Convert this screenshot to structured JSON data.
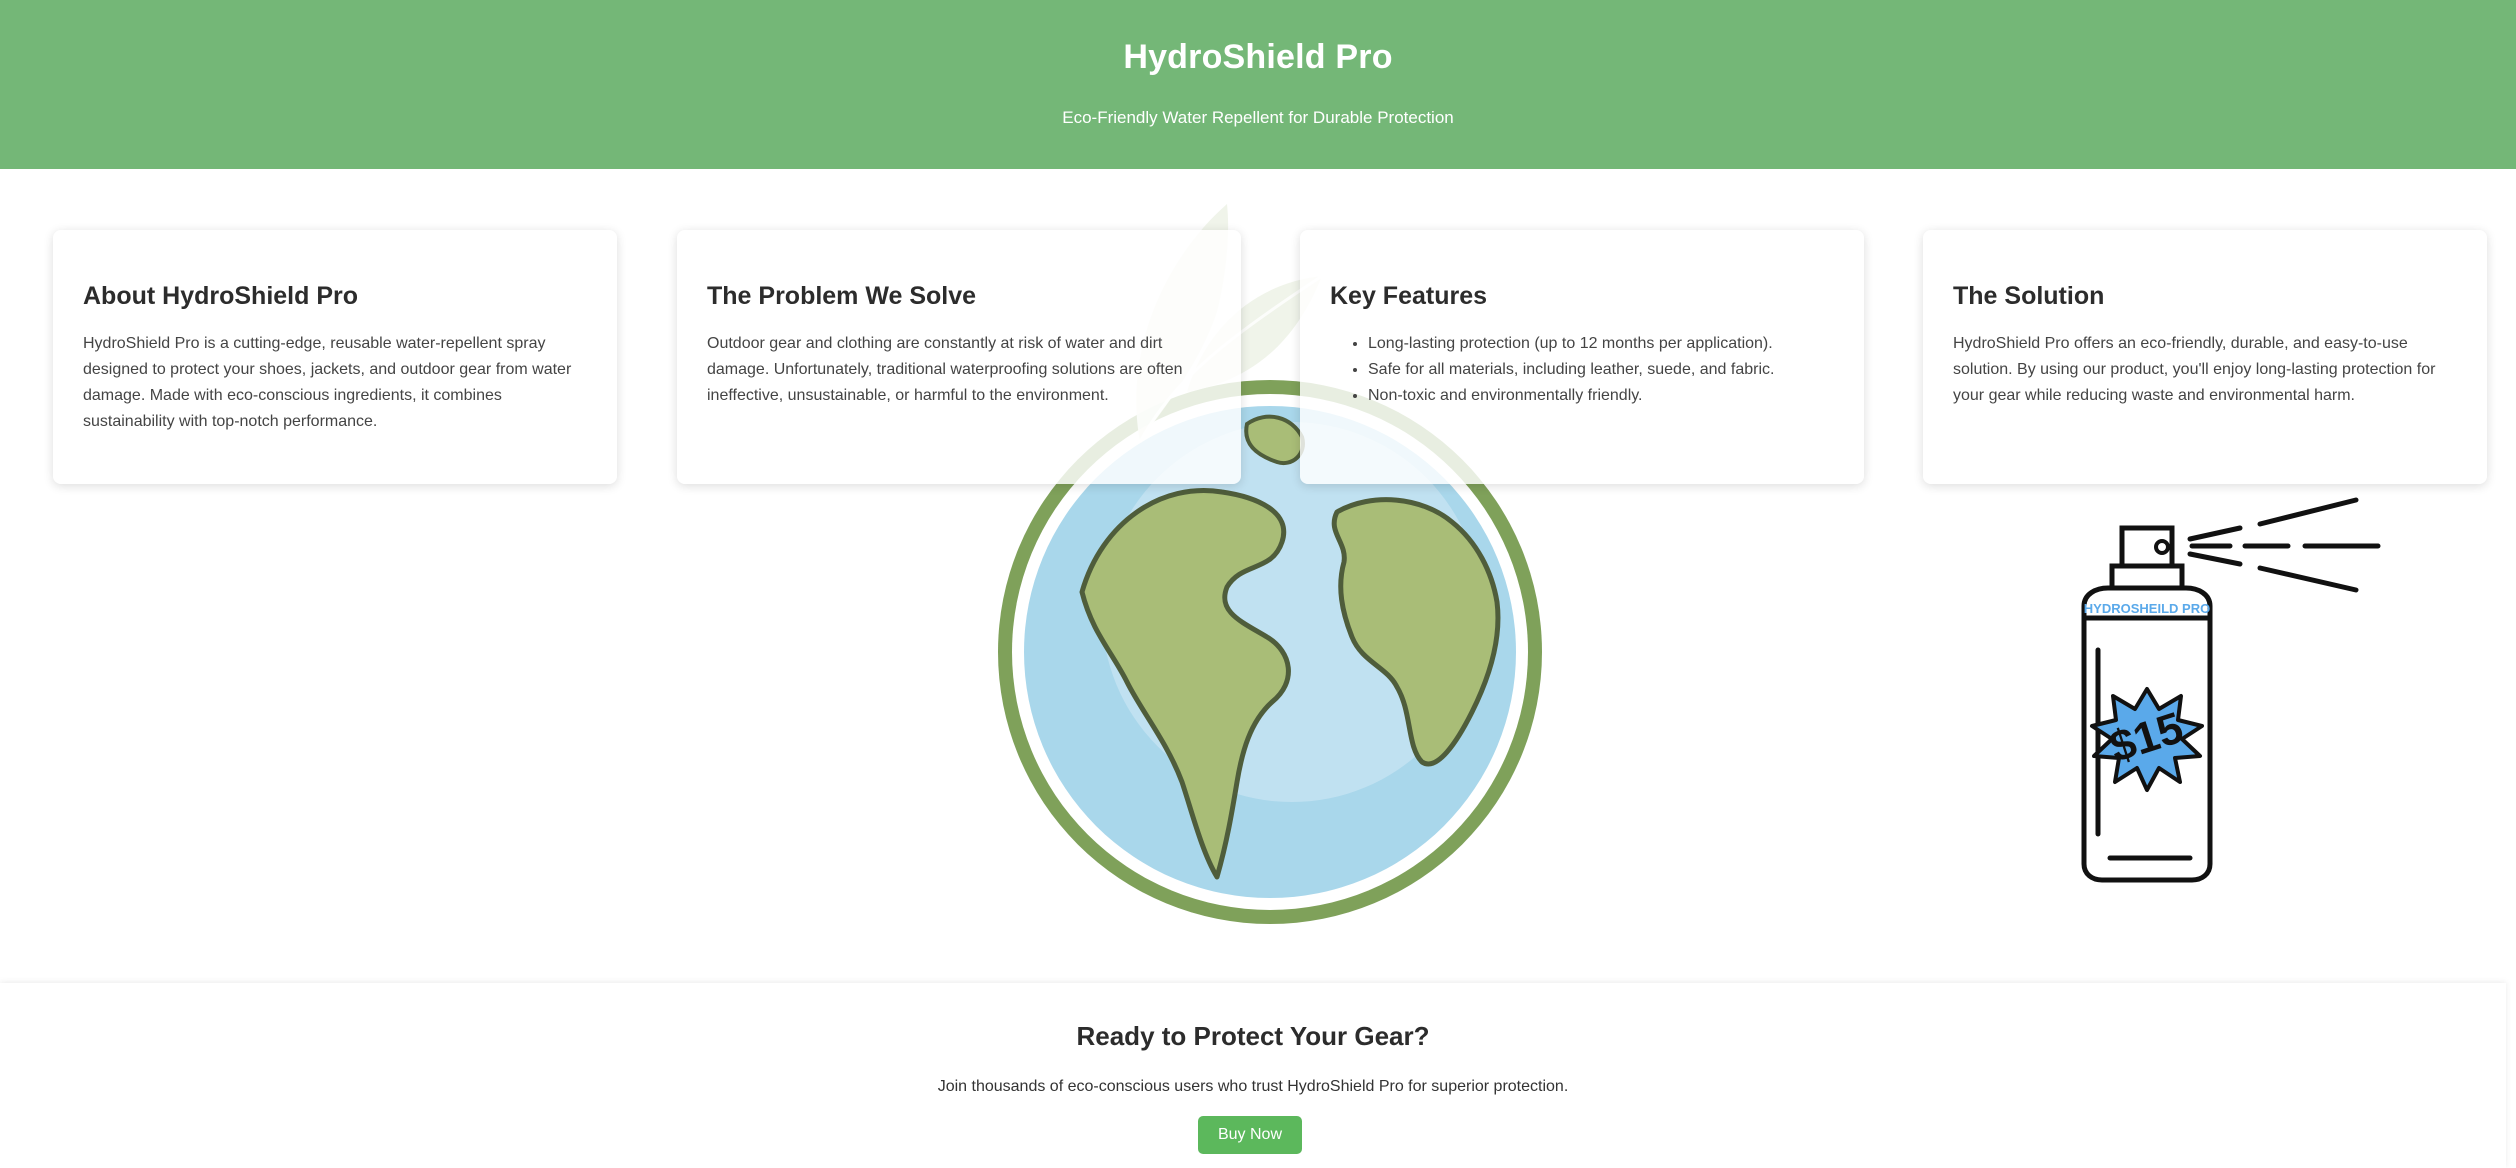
{
  "header": {
    "title": "HydroShield Pro",
    "subtitle": "Eco-Friendly Water Repellent for Durable Protection"
  },
  "cards": [
    {
      "title": "About HydroShield Pro",
      "text": "HydroShield Pro is a cutting-edge, reusable water-repellent spray designed to protect your shoes, jackets, and outdoor gear from water damage. Made with eco-conscious ingredients, it combines sustainability with top-notch performance."
    },
    {
      "title": "The Problem We Solve",
      "text": "Outdoor gear and clothing are constantly at risk of water and dirt damage. Unfortunately, traditional waterproofing solutions are often ineffective, unsustainable, or harmful to the environment."
    },
    {
      "title": "Key Features",
      "items": [
        "Long-lasting protection (up to 12 months per application).",
        "Safe for all materials, including leather, suede, and fabric.",
        "Non-toxic and environmentally friendly."
      ]
    },
    {
      "title": "The Solution",
      "text": "HydroShield Pro offers an eco-friendly, durable, and easy-to-use solution. By using our product, you'll enjoy long-lasting protection for your gear while reducing waste and environmental harm."
    }
  ],
  "product_image": {
    "brand_label": "HYDROSHEILD PRO",
    "price": "$15"
  },
  "cta": {
    "title": "Ready to Protect Your Gear?",
    "text": "Join thousands of eco-conscious users who trust HydroShield Pro for superior protection.",
    "button_label": "Buy Now"
  },
  "colors": {
    "header_bg": "#74b777",
    "button_bg": "#5cb85c",
    "globe_ring": "#7fa15a",
    "ocean": "#a8d8ec",
    "land": "#a9bd77",
    "badge": "#5aa9ea"
  }
}
